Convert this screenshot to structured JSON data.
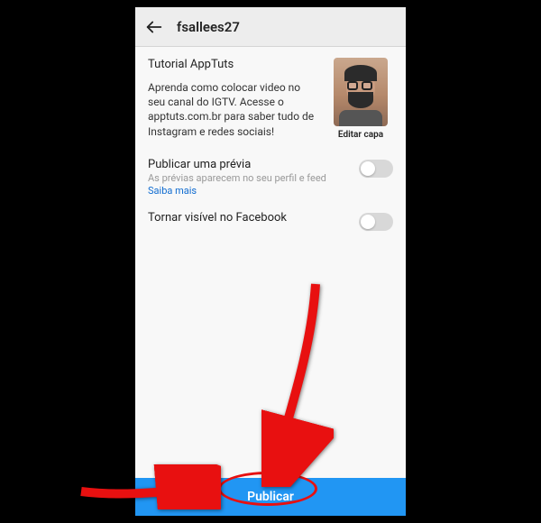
{
  "header": {
    "username": "fsallees27"
  },
  "post": {
    "title": "Tutorial AppTuts",
    "description": "Aprenda como colocar video no seu canal do IGTV. Acesse o apptuts.com.br para saber tudo de Instagram e redes sociais!",
    "edit_cover_label": "Editar capa"
  },
  "options": {
    "preview": {
      "title": "Publicar uma prévia",
      "subtitle": "As prévias aparecem no seu perfil e feed",
      "learn_more": "Saiba mais"
    },
    "facebook": {
      "title": "Tornar visível no Facebook"
    }
  },
  "publish_button": "Publicar",
  "colors": {
    "primary": "#2196f3",
    "annotation": "#e81010"
  }
}
